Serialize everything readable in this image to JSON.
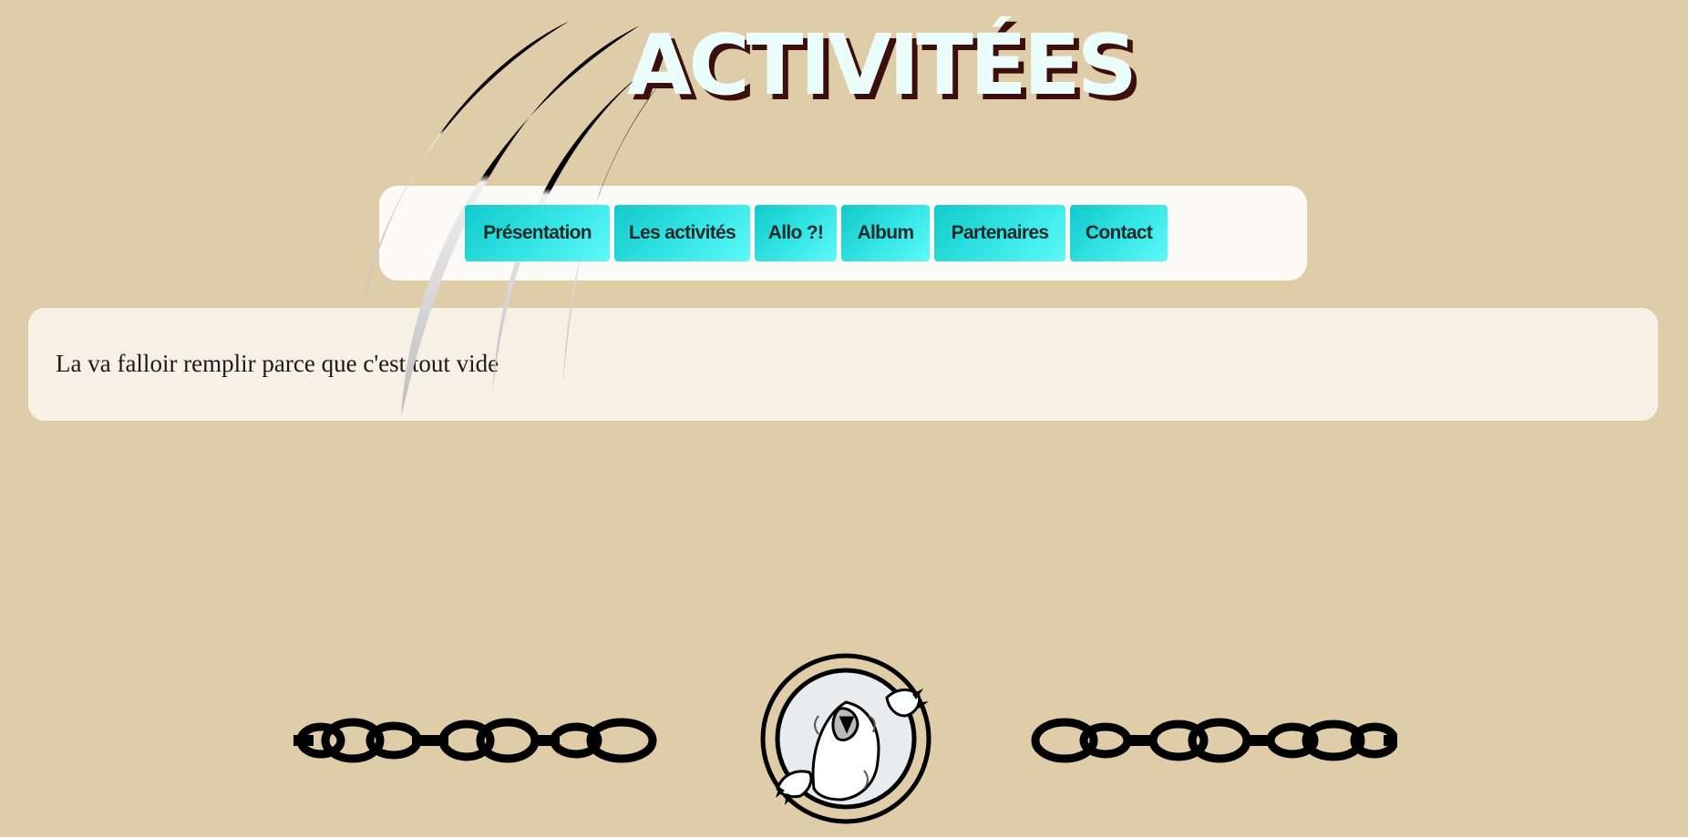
{
  "page": {
    "title": "ACTIVITÉES"
  },
  "nav": {
    "items": [
      {
        "label": "Présentation"
      },
      {
        "label": "Les activités"
      },
      {
        "label": "Allo ?!"
      },
      {
        "label": "Album"
      },
      {
        "label": "Partenaires"
      },
      {
        "label": "Contact"
      }
    ]
  },
  "content": {
    "text": "La va falloir remplir parce que c'est tout vide"
  },
  "decor": {
    "claw_icon": "claw-marks-icon",
    "chain_icon": "chain-icon",
    "logo_icon": "bear-emblem-icon"
  },
  "colors": {
    "background": "#dfcca8",
    "button": "#36e6e6",
    "title_fill": "#eafdfa",
    "title_shadow": "#3a0f0d"
  }
}
